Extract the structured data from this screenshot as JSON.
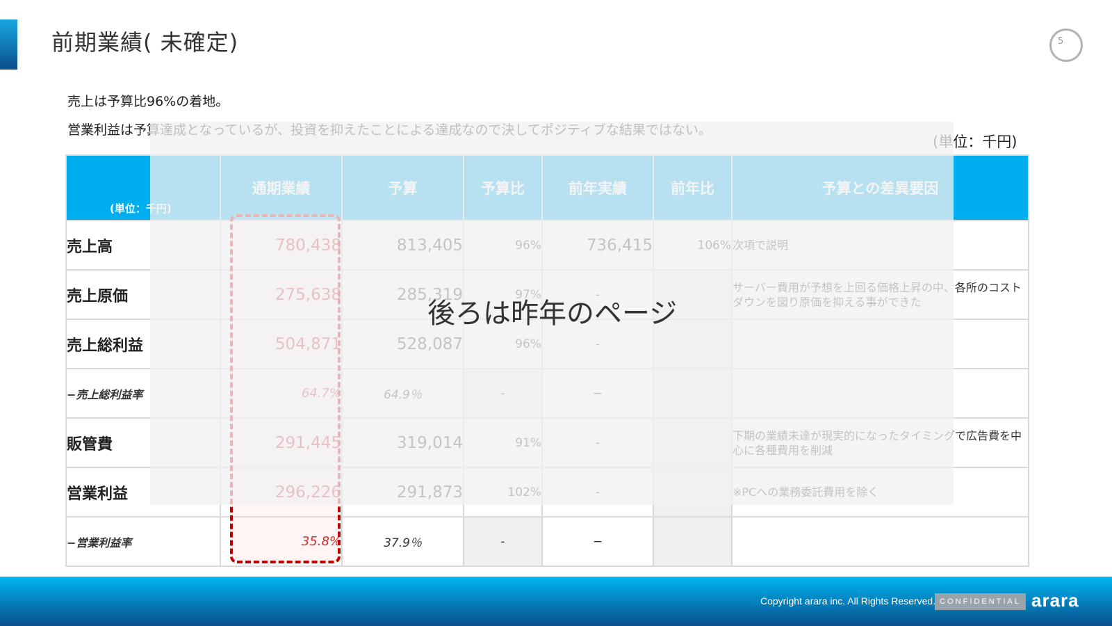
{
  "title": "前期業績( 未確定)",
  "page_number": "5",
  "summary": [
    "売上は予算比96%の着地。",
    "営業利益は予算達成となっているが、投資を抑えたことによる達成なので決してポジティブな結果ではない。"
  ],
  "unit": "(単位：千円)",
  "table": {
    "corner_label": "(単位：千円)",
    "headers": [
      "通期業績",
      "予算",
      "予算比",
      "前年実績",
      "前年比",
      "予算との差異要因"
    ],
    "rows": [
      {
        "label": "売上高",
        "actual": "780,438",
        "budget": "813,405",
        "budget_ratio": "96%",
        "prev_year": "736,415",
        "prev_ratio": "106%",
        "note": "次項で説明"
      },
      {
        "label": "売上原価",
        "actual": "275,638",
        "budget": "285,319",
        "budget_ratio": "97%",
        "prev_year": "-",
        "prev_ratio": "",
        "note": "サーバー費用が予想を上回る価格上昇の中、各所のコストダウンを図り原価を抑える事ができた"
      },
      {
        "label": "売上総利益",
        "actual": "504,871",
        "budget": "528,087",
        "budget_ratio": "96%",
        "prev_year": "-",
        "prev_ratio": "",
        "note": ""
      },
      {
        "label": "−売上総利益率",
        "actual": "64.7%",
        "budget": "64.9％",
        "budget_ratio": "-",
        "prev_year": "−",
        "prev_ratio": "",
        "note": ""
      },
      {
        "label": "販管費",
        "actual": "291,445",
        "budget": "319,014",
        "budget_ratio": "91%",
        "prev_year": "-",
        "prev_ratio": "",
        "note": "下期の業績未達が現実的になったタイミングで広告費を中心に各種費用を削減"
      },
      {
        "label": "営業利益",
        "actual": "296,226",
        "budget": "291,873",
        "budget_ratio": "102%",
        "prev_year": "-",
        "prev_ratio": "",
        "note": "※PCへの業務委託費用を除く"
      },
      {
        "label": "−営業利益率",
        "actual": "35.8%",
        "budget": "37.9％",
        "budget_ratio": "-",
        "prev_year": "−",
        "prev_ratio": "",
        "note": ""
      }
    ]
  },
  "overlay_text": "後ろは昨年のページ",
  "footer": {
    "copyright": "Copyright arara inc. All Rights Reserved.",
    "confidential": "CONFIDENTIAL",
    "logo": "arara"
  },
  "colors": {
    "accent": "#00aeef",
    "highlight": "#c00000",
    "footer_dark": "#0a4f8c"
  }
}
